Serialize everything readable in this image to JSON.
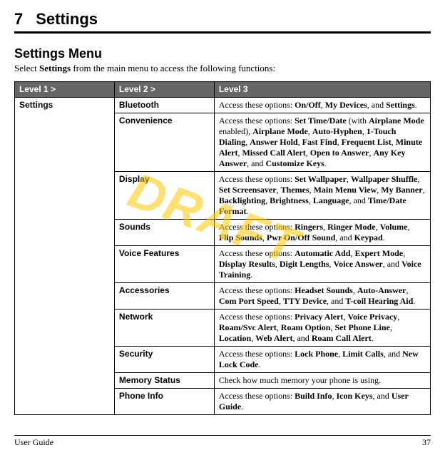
{
  "chapter": {
    "num": "7",
    "title": "Settings"
  },
  "section_title": "Settings Menu",
  "intro": {
    "pre": "Select ",
    "bold": "Settings",
    "post": " from the main menu to access the following functions:"
  },
  "watermark": "DRAFT",
  "headers": {
    "l1": "Level 1 >",
    "l2": "Level 2 >",
    "l3": "Level 3"
  },
  "l1": "Settings",
  "rows": [
    {
      "l2": "Bluetooth",
      "l3": "Access these options: <b>On/Off</b>, <b>My Devices</b>, and <b>Settings</b>."
    },
    {
      "l2": "Convenience",
      "l3": "Access these options: <b>Set Time/Date</b> (with <b>Airplane Mode</b> enabled), <b>Airplane Mode</b>, <b>Auto-Hyphen</b>, <b>1-Touch Dialing</b>, <b>Answer Hold</b>, <b>Fast Find</b>, <b>Frequent List</b>, <b>Minute Alert</b>, <b>Missed Call Alert</b>, <b>Open to Answer</b>, <b>Any Key Answer</b>, and <b>Customize Keys</b>."
    },
    {
      "l2": "Display",
      "l3": "Access these options: <b>Set Wallpaper</b>, <b>Wallpaper Shuffle</b>, <b>Set Screensaver</b>, <b>Themes</b>, <b>Main Menu View</b>, <b>My Banner</b>, <b>Backlighting</b>, <b>Brightness</b>, <b>Language</b>, and <b>Time/Date Format</b>."
    },
    {
      "l2": "Sounds",
      "l3": "Access these options: <b>Ringers</b>, <b>Ringer Mode</b>, <b>Volume</b>, <b>Flip Sounds</b>, <b>Pwr On/Off Sound</b>, and <b>Keypad</b>."
    },
    {
      "l2": "Voice Features",
      "l3": "Access these options: <b>Automatic Add</b>, <b>Expert Mode</b>, <b>Display Results</b>, <b>Digit Lengths</b>, <b>Voice Answer</b>, and <b>Voice Training</b>."
    },
    {
      "l2": "Accessories",
      "l3": "Access these options: <b>Headset Sounds</b>, <b>Auto-Answer</b>, <b>Com Port Speed</b>, <b>TTY Device</b>, and <b>T-coil Hearing Aid</b>."
    },
    {
      "l2": "Network",
      "l3": "Access these options: <b>Privacy Alert</b>, <b>Voice Privacy</b>, <b>Roam/Svc Alert</b>, <b>Roam Option</b>, <b>Set Phone Line</b>, <b>Location</b>, <b>Web Alert</b>, and <b>Roam Call Alert</b>."
    },
    {
      "l2": "Security",
      "l3": "Access these options: <b>Lock Phone</b>, <b>Limit Calls</b>, and <b>New Lock Code</b>."
    },
    {
      "l2": "Memory Status",
      "l3": "Check how much memory your phone is using."
    },
    {
      "l2": "Phone Info",
      "l3": "Access these options: <b>Build Info</b>, <b>Icon Keys</b>, and <b>User Guide</b>."
    }
  ],
  "footer": {
    "left": "User Guide",
    "right": "37"
  }
}
